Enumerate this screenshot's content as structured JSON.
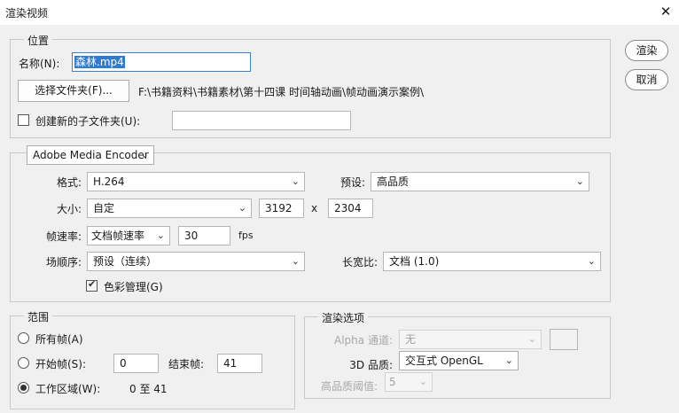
{
  "window": {
    "title": "渲染视频",
    "close_glyph": "✕"
  },
  "side_buttons": {
    "render": "渲染",
    "cancel": "取消"
  },
  "location": {
    "legend": "位置",
    "name_label": "名称(N):",
    "name_value": "森林.mp4",
    "choose_folder_button": "选择文件夹(F)...",
    "folder_path": "F:\\书籍资料\\书籍素材\\第十四课 时间轴动画\\帧动画演示案例\\",
    "subfolder_checkbox_label": "创建新的子文件夹(U):",
    "subfolder_checked": false,
    "subfolder_value": ""
  },
  "encoder": {
    "selected": "Adobe Media Encoder",
    "format_label": "格式:",
    "format_value": "H.264",
    "preset_label": "预设:",
    "preset_value": "高品质",
    "size_label": "大小:",
    "size_value": "自定",
    "width": "3192",
    "times": "x",
    "height": "2304",
    "framerate_label": "帧速率:",
    "framerate_mode": "文档帧速率",
    "framerate_value": "30",
    "fps_unit": "fps",
    "field_order_label": "场顺序:",
    "field_order_value": "预设（连续）",
    "aspect_label": "长宽比:",
    "aspect_value": "文档 (1.0)",
    "color_mgmt_label": "色彩管理(G)",
    "color_mgmt_checked": true
  },
  "range": {
    "legend": "范围",
    "all_frames_label": "所有帧(A)",
    "start_frame_label": "开始帧(S):",
    "start_frame_value": "0",
    "end_frame_label": "结束帧:",
    "end_frame_value": "41",
    "work_area_label": "工作区域(W):",
    "work_area_value": "0 至 41",
    "selected": "work_area"
  },
  "render_options": {
    "legend": "渲染选项",
    "alpha_label": "Alpha 通道:",
    "alpha_value": "无",
    "quality_3d_label": "3D 品质:",
    "quality_3d_value": "交互式 OpenGL",
    "hq_threshold_label": "高品质阈值:",
    "hq_threshold_value": "5"
  },
  "icons": {
    "dropdown": "chevron-down-icon",
    "check": "checkmark-icon",
    "close": "close-icon"
  },
  "colors": {
    "selection": "#2f7bd2",
    "window_bg": "#f0f0f0",
    "titlebar_bg": "#ffffff"
  }
}
